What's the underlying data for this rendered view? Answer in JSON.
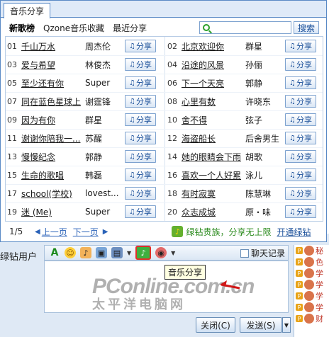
{
  "panel": {
    "tab_label": "音乐分享",
    "subtabs": [
      "新歌榜",
      "Qzone音乐收藏",
      "最近分享"
    ],
    "search_placeholder": "",
    "search_button": "搜索",
    "share_label": "分享",
    "songs": [
      {
        "num": "01",
        "title": "千山万水",
        "artist": "周杰伦"
      },
      {
        "num": "02",
        "title": "北京欢迎你",
        "artist": "群星"
      },
      {
        "num": "03",
        "title": "爱与希望",
        "artist": "林俊杰"
      },
      {
        "num": "04",
        "title": "沿途的风景",
        "artist": "孙俪"
      },
      {
        "num": "05",
        "title": "至少还有你",
        "artist": "Super"
      },
      {
        "num": "06",
        "title": "下一个天亮",
        "artist": "郭静"
      },
      {
        "num": "07",
        "title": "同在蓝色星球上",
        "artist": "谢霆锋"
      },
      {
        "num": "08",
        "title": "心里有数",
        "artist": "许晓东"
      },
      {
        "num": "09",
        "title": "因为有你",
        "artist": "群星"
      },
      {
        "num": "10",
        "title": "舍不得",
        "artist": "弦子"
      },
      {
        "num": "11",
        "title": "谢谢你陪我一...",
        "artist": "苏醒"
      },
      {
        "num": "12",
        "title": "海盗船长",
        "artist": "后舍男生"
      },
      {
        "num": "13",
        "title": "慢慢纪念",
        "artist": "郭静"
      },
      {
        "num": "14",
        "title": "她的眼睛会下雨",
        "artist": "胡歌"
      },
      {
        "num": "15",
        "title": "生命的歌唱",
        "artist": "韩磊"
      },
      {
        "num": "16",
        "title": "喜欢一个人好累",
        "artist": "泳儿"
      },
      {
        "num": "17",
        "title": "school(学校)",
        "artist": "lovest..."
      },
      {
        "num": "18",
        "title": "有时寂寞",
        "artist": "陈慧琳"
      },
      {
        "num": "19",
        "title": "迷 (Me)",
        "artist": "Super"
      },
      {
        "num": "20",
        "title": "众志成城",
        "artist": "原・味"
      }
    ],
    "footer": {
      "page": "1/5",
      "prev": "上一页",
      "next": "下一页",
      "promo": "绿钻贵族，分享无上限",
      "open": "开通绿钻"
    }
  },
  "chat": {
    "left_text": "绿钻用户",
    "history": "聊天记录",
    "tooltip": "音乐分享",
    "close": "关闭(C)",
    "send": "发送(S)",
    "watermark_en": "PConline.com.cn",
    "watermark_cn": "太平洋电脑网",
    "contacts": [
      "秘",
      "色",
      "学",
      "学",
      "学",
      "学",
      "财"
    ]
  }
}
